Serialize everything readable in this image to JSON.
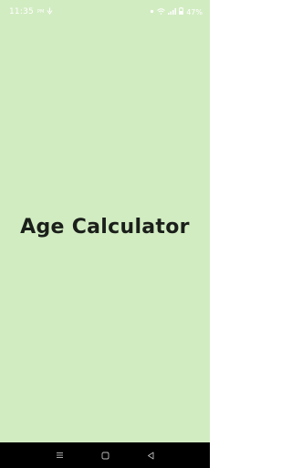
{
  "status_bar": {
    "time": "11:35",
    "ampm": "PM",
    "battery_percent": "47%",
    "icons": [
      "notification-icon",
      "alarm-icon",
      "wifi-icon",
      "signal-icon",
      "battery-icon"
    ]
  },
  "splash": {
    "title": "Age Calculator"
  },
  "nav_bar": {
    "buttons": [
      "recent-apps",
      "home",
      "back"
    ]
  },
  "colors": {
    "background": "#d2ecc2",
    "title": "#1a1f1a",
    "nav_bar": "#000000"
  }
}
